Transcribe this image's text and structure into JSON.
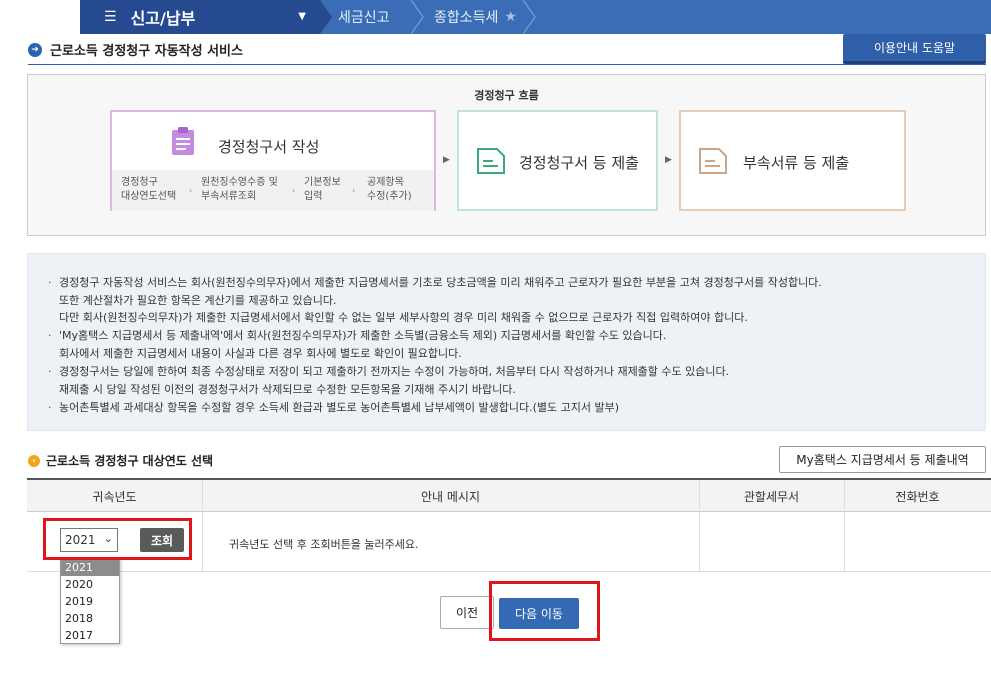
{
  "nav": {
    "menu_title": "신고/납부",
    "breadcrumbs": [
      "세금신고",
      "종합소득세"
    ]
  },
  "section": {
    "title": "근로소득 경정청구 자동작성 서비스",
    "help_button": "이용안내 도움말"
  },
  "flow": {
    "title": "경정청구 흐름",
    "card1_title": "경정청구서 작성",
    "steps": [
      {
        "line1": "경정청구",
        "line2": "대상연도선택"
      },
      {
        "line1": "원천징수영수증 및",
        "line2": "부속서류조회"
      },
      {
        "line1": "기본정보",
        "line2": "입력"
      },
      {
        "line1": "공제항목",
        "line2": "수정(추가)"
      }
    ],
    "card2_title": "경정청구서 등 제출",
    "card3_title": "부속서류 등 제출"
  },
  "info": {
    "lines": [
      {
        "bullet": "·",
        "text": "경정청구 자동작성 서비스는 회사(원천징수의무자)에서 제출한 지급명세서를 기초로 당초금액을 미리 채워주고 근로자가 필요한 부분을 고쳐 경정청구서를 작성합니다."
      },
      {
        "bullet": "",
        "text": "또한 계산절차가 필요한 항목은 계산기를 제공하고 있습니다."
      },
      {
        "bullet": "",
        "text": "다만 회사(원천징수의무자)가 제출한 지급명세서에서 확인할 수 없는 일부 세부사항의 경우 미리 채워줄 수 없으므로 근로자가 직접 입력하여야 합니다."
      },
      {
        "bullet": "·",
        "text": "'My홈택스 지급명세서 등 제출내역'에서 회사(원천징수의무자)가 제출한 소득별(금융소득 제외) 지급명세서를 확인할 수도 있습니다."
      },
      {
        "bullet": "",
        "text": "회사에서 제출한 지급명세서 내용이 사실과 다른 경우 회사에 별도로 확인이 필요합니다."
      },
      {
        "bullet": "·",
        "text": "경정청구서는 당일에 한하여 최종 수정상태로 저장이 되고 제출하기 전까지는 수정이 가능하며, 처음부터 다시 작성하거나 재제출할 수도 있습니다."
      },
      {
        "bullet": "",
        "text": "재제출 시 당일 작성된 이전의 경정청구서가 삭제되므로 수정한 모든항목을 기재해 주시기 바랍니다."
      },
      {
        "bullet": "·",
        "text": "농어촌특별세 과세대상 항목을 수정할 경우 소득세 환급과 별도로 농어촌특별세 납부세액이 발생합니다.(별도 고지서 발부)"
      }
    ]
  },
  "year_select": {
    "title": "근로소득 경정청구 대상연도 선택",
    "mytax_button": "My홈택스 지급명세서 등 제출내역",
    "headers": [
      "귀속년도",
      "안내 메시지",
      "관할세무서",
      "전화번호"
    ],
    "selected_year": "2021",
    "search_button": "조회",
    "message": "귀속년도 선택 후 조회버튼을 눌러주세요.",
    "options": [
      "2021",
      "2020",
      "2019",
      "2018",
      "2017"
    ]
  },
  "footer": {
    "prev_button": "이전",
    "next_button": "다음 이동"
  },
  "colors": {
    "nav_dark": "#254a8f",
    "nav_light": "#3a6db5",
    "highlight": "#e0141d",
    "primary_button": "#3469b4"
  }
}
